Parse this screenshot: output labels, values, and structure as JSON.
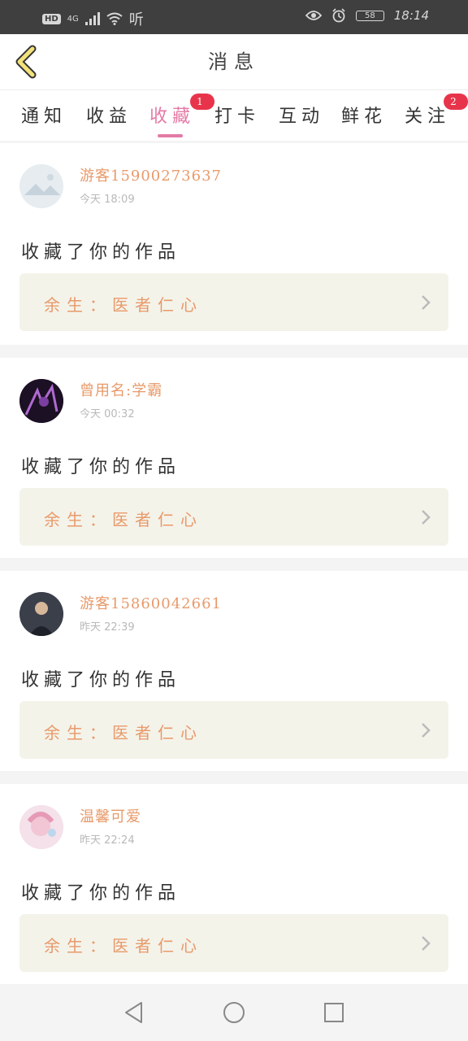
{
  "status_bar": {
    "hd": "HD",
    "network": "4G",
    "hifi": "听",
    "battery": "58",
    "time": "18:14"
  },
  "header": {
    "title": "消息"
  },
  "tabs": [
    {
      "label": "通知",
      "active": false,
      "badge": ""
    },
    {
      "label": "收益",
      "active": false,
      "badge": ""
    },
    {
      "label": "收藏",
      "active": true,
      "badge": "1"
    },
    {
      "label": "打卡",
      "active": false,
      "badge": ""
    },
    {
      "label": "互动",
      "active": false,
      "badge": ""
    },
    {
      "label": "鲜花",
      "active": false,
      "badge": ""
    },
    {
      "label": "关注",
      "active": false,
      "badge": "2"
    }
  ],
  "messages": [
    {
      "username": "游客15900273637",
      "time": "今天 18:09",
      "action": "收藏了你的作品",
      "work_title": "余生：医者仁心"
    },
    {
      "username": "曾用名:学霸",
      "time": "今天 00:32",
      "action": "收藏了你的作品",
      "work_title": "余生：医者仁心"
    },
    {
      "username": "游客15860042661",
      "time": "昨天 22:39",
      "action": "收藏了你的作品",
      "work_title": "余生：医者仁心"
    },
    {
      "username": "温馨可爱",
      "time": "昨天 22:24",
      "action": "收藏了你的作品",
      "work_title": "余生：医者仁心"
    }
  ],
  "colors": {
    "accent_pink": "#e47aa6",
    "name_orange": "#e89a6a",
    "badge_red": "#e8344a",
    "back_yellow": "#f2e27a"
  }
}
